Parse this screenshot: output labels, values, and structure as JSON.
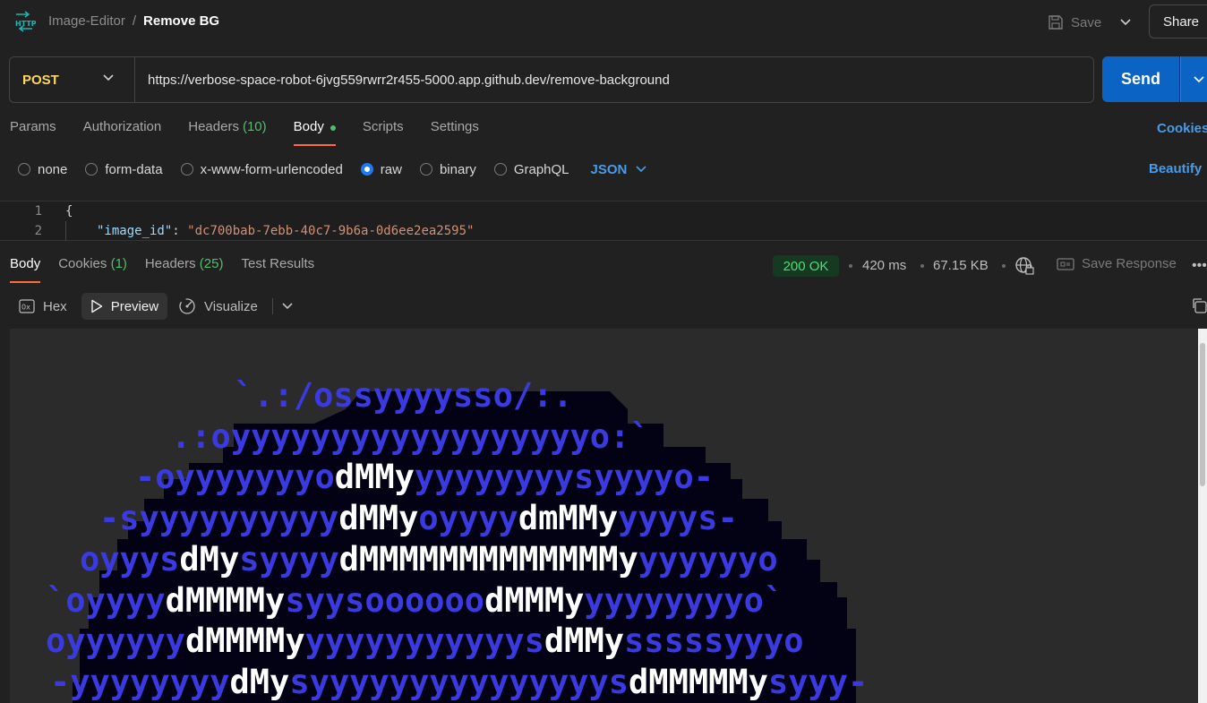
{
  "header": {
    "breadcrumb_parent": "Image-Editor",
    "breadcrumb_sep": "/",
    "breadcrumb_current": "Remove BG",
    "save_label": "Save",
    "share_label": "Share"
  },
  "request": {
    "method": "POST",
    "url": "https://verbose-space-robot-6jvg559rwrr2r455-5000.app.github.dev/remove-background",
    "send_label": "Send"
  },
  "request_tabs": [
    {
      "label": "Params",
      "count": ""
    },
    {
      "label": "Authorization",
      "count": ""
    },
    {
      "label": "Headers",
      "count": "(10)"
    },
    {
      "label": "Body",
      "count": ""
    },
    {
      "label": "Scripts",
      "count": ""
    },
    {
      "label": "Settings",
      "count": ""
    }
  ],
  "cookies_link": "Cookies",
  "body_types": [
    "none",
    "form-data",
    "x-www-form-urlencoded",
    "raw",
    "binary",
    "GraphQL"
  ],
  "body_format": "JSON",
  "beautify_label": "Beautify",
  "editor": {
    "lines": [
      {
        "num": "1",
        "text": "{"
      },
      {
        "num": "2",
        "key": "\"image_id\"",
        "colon": ": ",
        "value": "\"dc700bab-7ebb-40c7-9b6a-0d6ee2ea2595\""
      }
    ]
  },
  "response_tabs": [
    {
      "label": "Body",
      "count": ""
    },
    {
      "label": "Cookies",
      "count": "(1)"
    },
    {
      "label": "Headers",
      "count": "(25)"
    },
    {
      "label": "Test Results",
      "count": ""
    }
  ],
  "response_meta": {
    "status": "200 OK",
    "time": "420 ms",
    "size": "67.15 KB",
    "save_response_label": "Save Response"
  },
  "view_modes": {
    "hex": "Hex",
    "preview": "Preview",
    "visualize": "Visualize"
  },
  "colors": {
    "accent_orange": "#ff6c37",
    "link_blue": "#4a9be8",
    "send_blue": "#0b63c4",
    "ok_green": "#4fdc7a",
    "method_yellow": "#ffd75e",
    "ascii_blue": "#3a3ae0"
  },
  "ascii_art": [
    [
      {
        "t": "      `.:/ossyyyysso/:.",
        "c": "b"
      }
    ],
    [
      {
        "t": "   .:oyyyyyyyyyyyyyyyyyyo:`",
        "c": "b"
      }
    ],
    [
      {
        "t": "  -oyyyyyyyo",
        "c": "b"
      },
      {
        "t": "dMMy",
        "c": "w"
      },
      {
        "t": "yyyyyyyysyyyyo-",
        "c": "b"
      }
    ],
    [
      {
        "t": " -syyyyyyyyyy",
        "c": "b"
      },
      {
        "t": "dMMy",
        "c": "w"
      },
      {
        "t": "oyyyy",
        "c": "b"
      },
      {
        "t": "dmMMy",
        "c": "w"
      },
      {
        "t": "yyyys-",
        "c": "b"
      }
    ],
    [
      {
        "t": "oyyys",
        "c": "b"
      },
      {
        "t": "dMy",
        "c": "w"
      },
      {
        "t": "syyyy",
        "c": "b"
      },
      {
        "t": "dMMMMMMMMMMMMMy",
        "c": "w"
      },
      {
        "t": "yyyyyyo",
        "c": "b"
      }
    ],
    [
      {
        "t": "`oyyyy",
        "c": "b"
      },
      {
        "t": "dMMMMy",
        "c": "w"
      },
      {
        "t": "syysoooooo",
        "c": "b"
      },
      {
        "t": "dMMMy",
        "c": "w"
      },
      {
        "t": "yyyyyyyyo`",
        "c": "b"
      }
    ],
    [
      {
        "t": "oyyyyyy",
        "c": "b"
      },
      {
        "t": "dMMMMy",
        "c": "w"
      },
      {
        "t": "yyyyyyyyyyys",
        "c": "b"
      },
      {
        "t": "dMMy",
        "c": "w"
      },
      {
        "t": "sssssyyyo",
        "c": "b"
      }
    ],
    [
      {
        "t": "-yyyyyyyy",
        "c": "b"
      },
      {
        "t": "dMy",
        "c": "w"
      },
      {
        "t": "syyyyyyyyyyyyyyys",
        "c": "b"
      },
      {
        "t": "dMMMMMy",
        "c": "w"
      },
      {
        "t": "syyy-",
        "c": "b"
      }
    ]
  ]
}
